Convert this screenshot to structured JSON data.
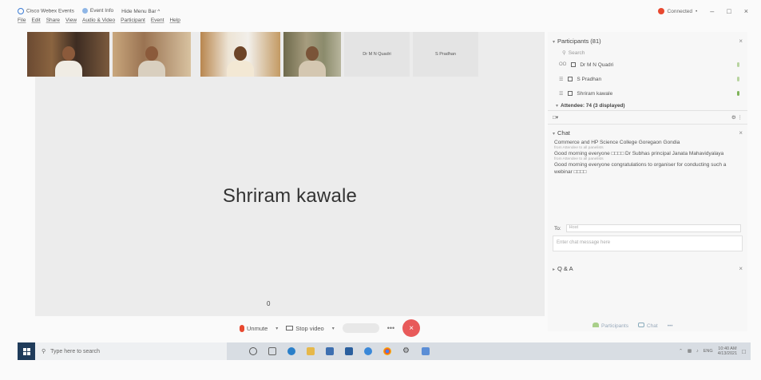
{
  "titlebar": {
    "app_name": "Cisco Webex Events",
    "event_info": "Event Info",
    "hide_menu": "Hide Menu Bar ^",
    "status": "Connected",
    "status_chevron": "•",
    "minimize": "–",
    "maximize": "□",
    "close": "×"
  },
  "menu": [
    "File",
    "Edit",
    "Share",
    "View",
    "Audio & Video",
    "Participant",
    "Event",
    "Help"
  ],
  "video": {
    "name_tiles": [
      "Dr M N Quadri",
      "S Pradhan"
    ],
    "active_speaker": "Shriram kawale",
    "indicator": "0"
  },
  "controls": {
    "unmute": "Unmute",
    "stop_video": "Stop video",
    "more": "•••",
    "end": "×"
  },
  "participants": {
    "title": "Participants (81)",
    "search_placeholder": "Search",
    "rows": [
      {
        "name": "Dr M N Quadri",
        "icon": "OO"
      },
      {
        "name": "S Pradhan",
        "icon": "☰"
      },
      {
        "name": "Shriram kawale",
        "icon": "☰"
      }
    ],
    "attendee_label": "Attendee: 74 (3 displayed)"
  },
  "chat": {
    "title": "Chat",
    "messages": [
      {
        "text": "Commerce and HP Science College Goregaon Gondia",
        "meta": "from Attendee to all panelists"
      },
      {
        "text": "Good morning everyone □□□□ Dr Subhas principal Janata Mahavidyalaya",
        "meta": "from Attendee to all panelists"
      },
      {
        "text": "Good morning everyone congratulations to organiser for conducting such a webinar □□□□",
        "meta": ""
      }
    ],
    "to_label": "To:",
    "to_value": "Host",
    "input_placeholder": "Enter chat message here"
  },
  "qa": {
    "title": "Q & A"
  },
  "panel_footer": {
    "participants": "Participants",
    "chat": "Chat",
    "more": "•••"
  },
  "taskbar": {
    "search_placeholder": "Type here to search",
    "lang": "ENG",
    "time": "10:40 AM",
    "date": "4/13/2021"
  }
}
